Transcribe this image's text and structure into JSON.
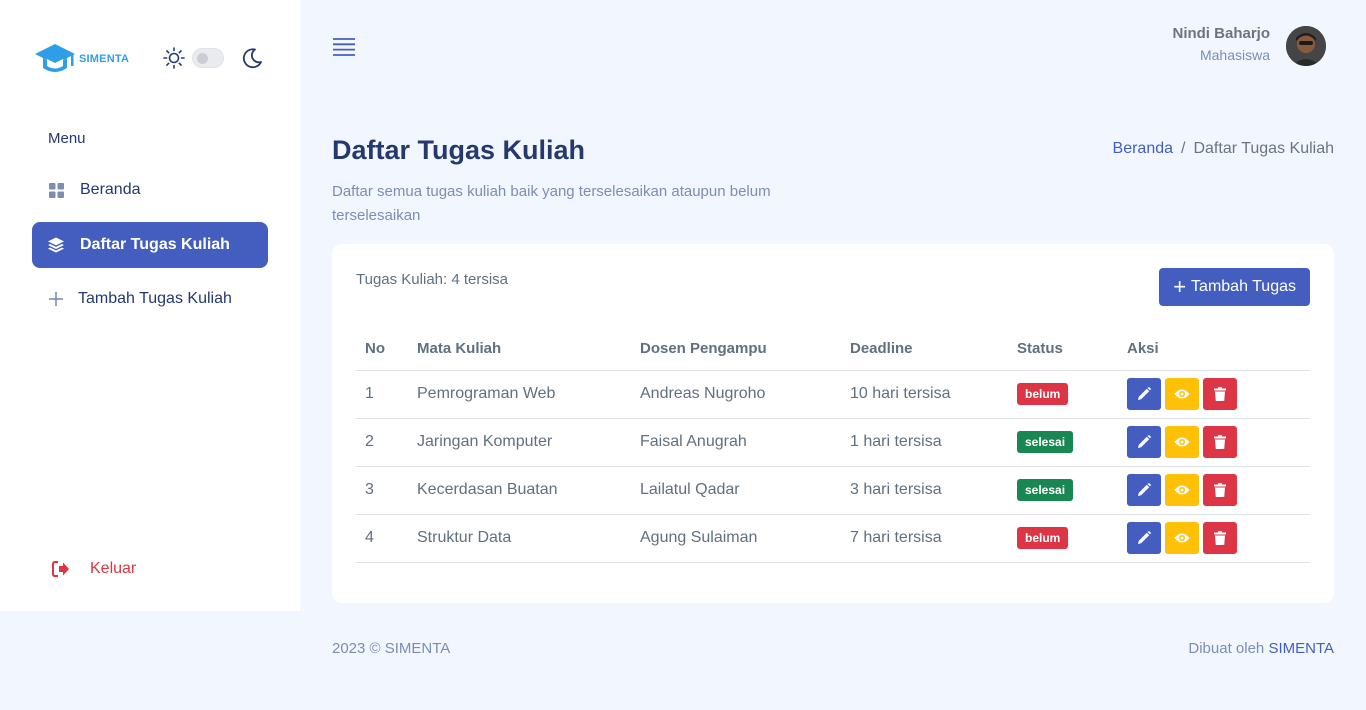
{
  "sidebar": {
    "logo_text": "SIMENTA",
    "menu_title": "Menu",
    "items": [
      {
        "label": "Beranda",
        "icon": "grid-icon"
      },
      {
        "label": "Daftar Tugas Kuliah",
        "icon": "stack-icon",
        "active": true
      },
      {
        "label": "Tambah Tugas Kuliah",
        "icon": "plus-icon"
      }
    ],
    "logout_label": "Keluar"
  },
  "header": {
    "user_name": "Nindi Baharjo",
    "user_role": "Mahasiswa"
  },
  "page": {
    "title": "Daftar Tugas Kuliah",
    "subtitle": "Daftar semua tugas kuliah baik yang terselesaikan ataupun belum terselesaikan",
    "breadcrumb": {
      "home": "Beranda",
      "separator": "/",
      "current": "Daftar Tugas Kuliah"
    }
  },
  "card": {
    "count_label": "Tugas Kuliah: 4 tersisa",
    "add_button": "Tambah Tugas",
    "columns": [
      "No",
      "Mata Kuliah",
      "Dosen Pengampu",
      "Deadline",
      "Status",
      "Aksi"
    ],
    "rows": [
      {
        "no": "1",
        "course": "Pemrograman Web",
        "lecturer": "Andreas Nugroho",
        "deadline": "10 hari tersisa",
        "status": "belum"
      },
      {
        "no": "2",
        "course": "Jaringan Komputer",
        "lecturer": "Faisal Anugrah",
        "deadline": "1 hari tersisa",
        "status": "selesai"
      },
      {
        "no": "3",
        "course": "Kecerdasan Buatan",
        "lecturer": "Lailatul Qadar",
        "deadline": "3 hari tersisa",
        "status": "selesai"
      },
      {
        "no": "4",
        "course": "Struktur Data",
        "lecturer": "Agung Sulaiman",
        "deadline": "7 hari tersisa",
        "status": "belum"
      }
    ]
  },
  "footer": {
    "left": "2023 © SIMENTA",
    "right_prefix": "Dibuat oleh",
    "right_brand": "SIMENTA"
  },
  "colors": {
    "primary": "#435ebe",
    "danger": "#dc3545",
    "success": "#198754",
    "warning": "#ffc107",
    "background": "#f2f7ff"
  }
}
